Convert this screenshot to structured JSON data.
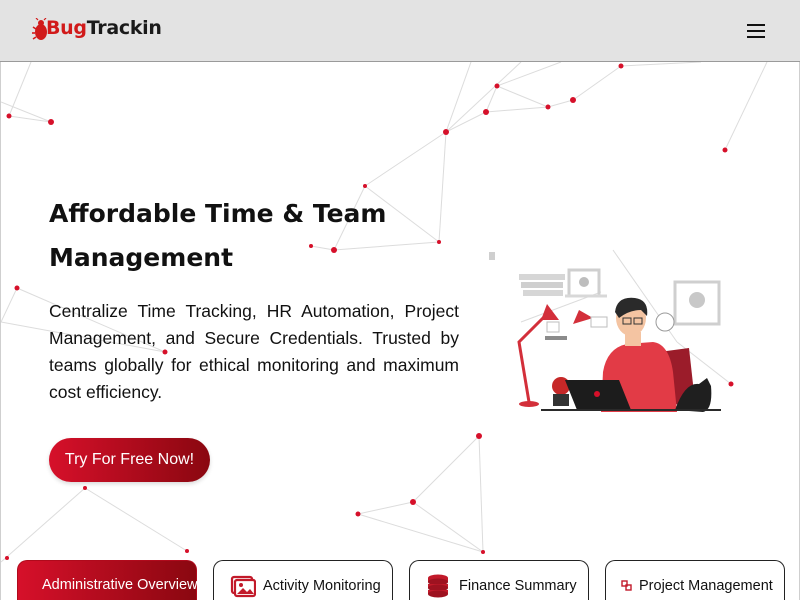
{
  "brand": {
    "name_part1": "Bug",
    "name_part2": "Trackin",
    "accent_color": "#d11a1a"
  },
  "header": {
    "menu_icon": "hamburger-menu-icon"
  },
  "hero": {
    "title": "Affordable Time & Team Management",
    "description": "Centralize Time Tracking, HR Automation, Project Management, and Secure Credentials. Trusted by teams globally for ethical monitoring and maximum cost efficiency.",
    "cta_label": "Try For Free Now!",
    "cta_gradient": [
      "#d6102a",
      "#8a0710"
    ],
    "illustration": "person-working-at-laptop-illustration"
  },
  "tabs": [
    {
      "label": "Administrative Overview",
      "icon": "",
      "active": true
    },
    {
      "label": "Activity Monitoring",
      "icon": "image-gallery-icon",
      "active": false
    },
    {
      "label": "Finance Summary",
      "icon": "coin-stack-icon",
      "active": false
    },
    {
      "label": "Project Management",
      "icon": "project-icon",
      "active": false
    }
  ]
}
